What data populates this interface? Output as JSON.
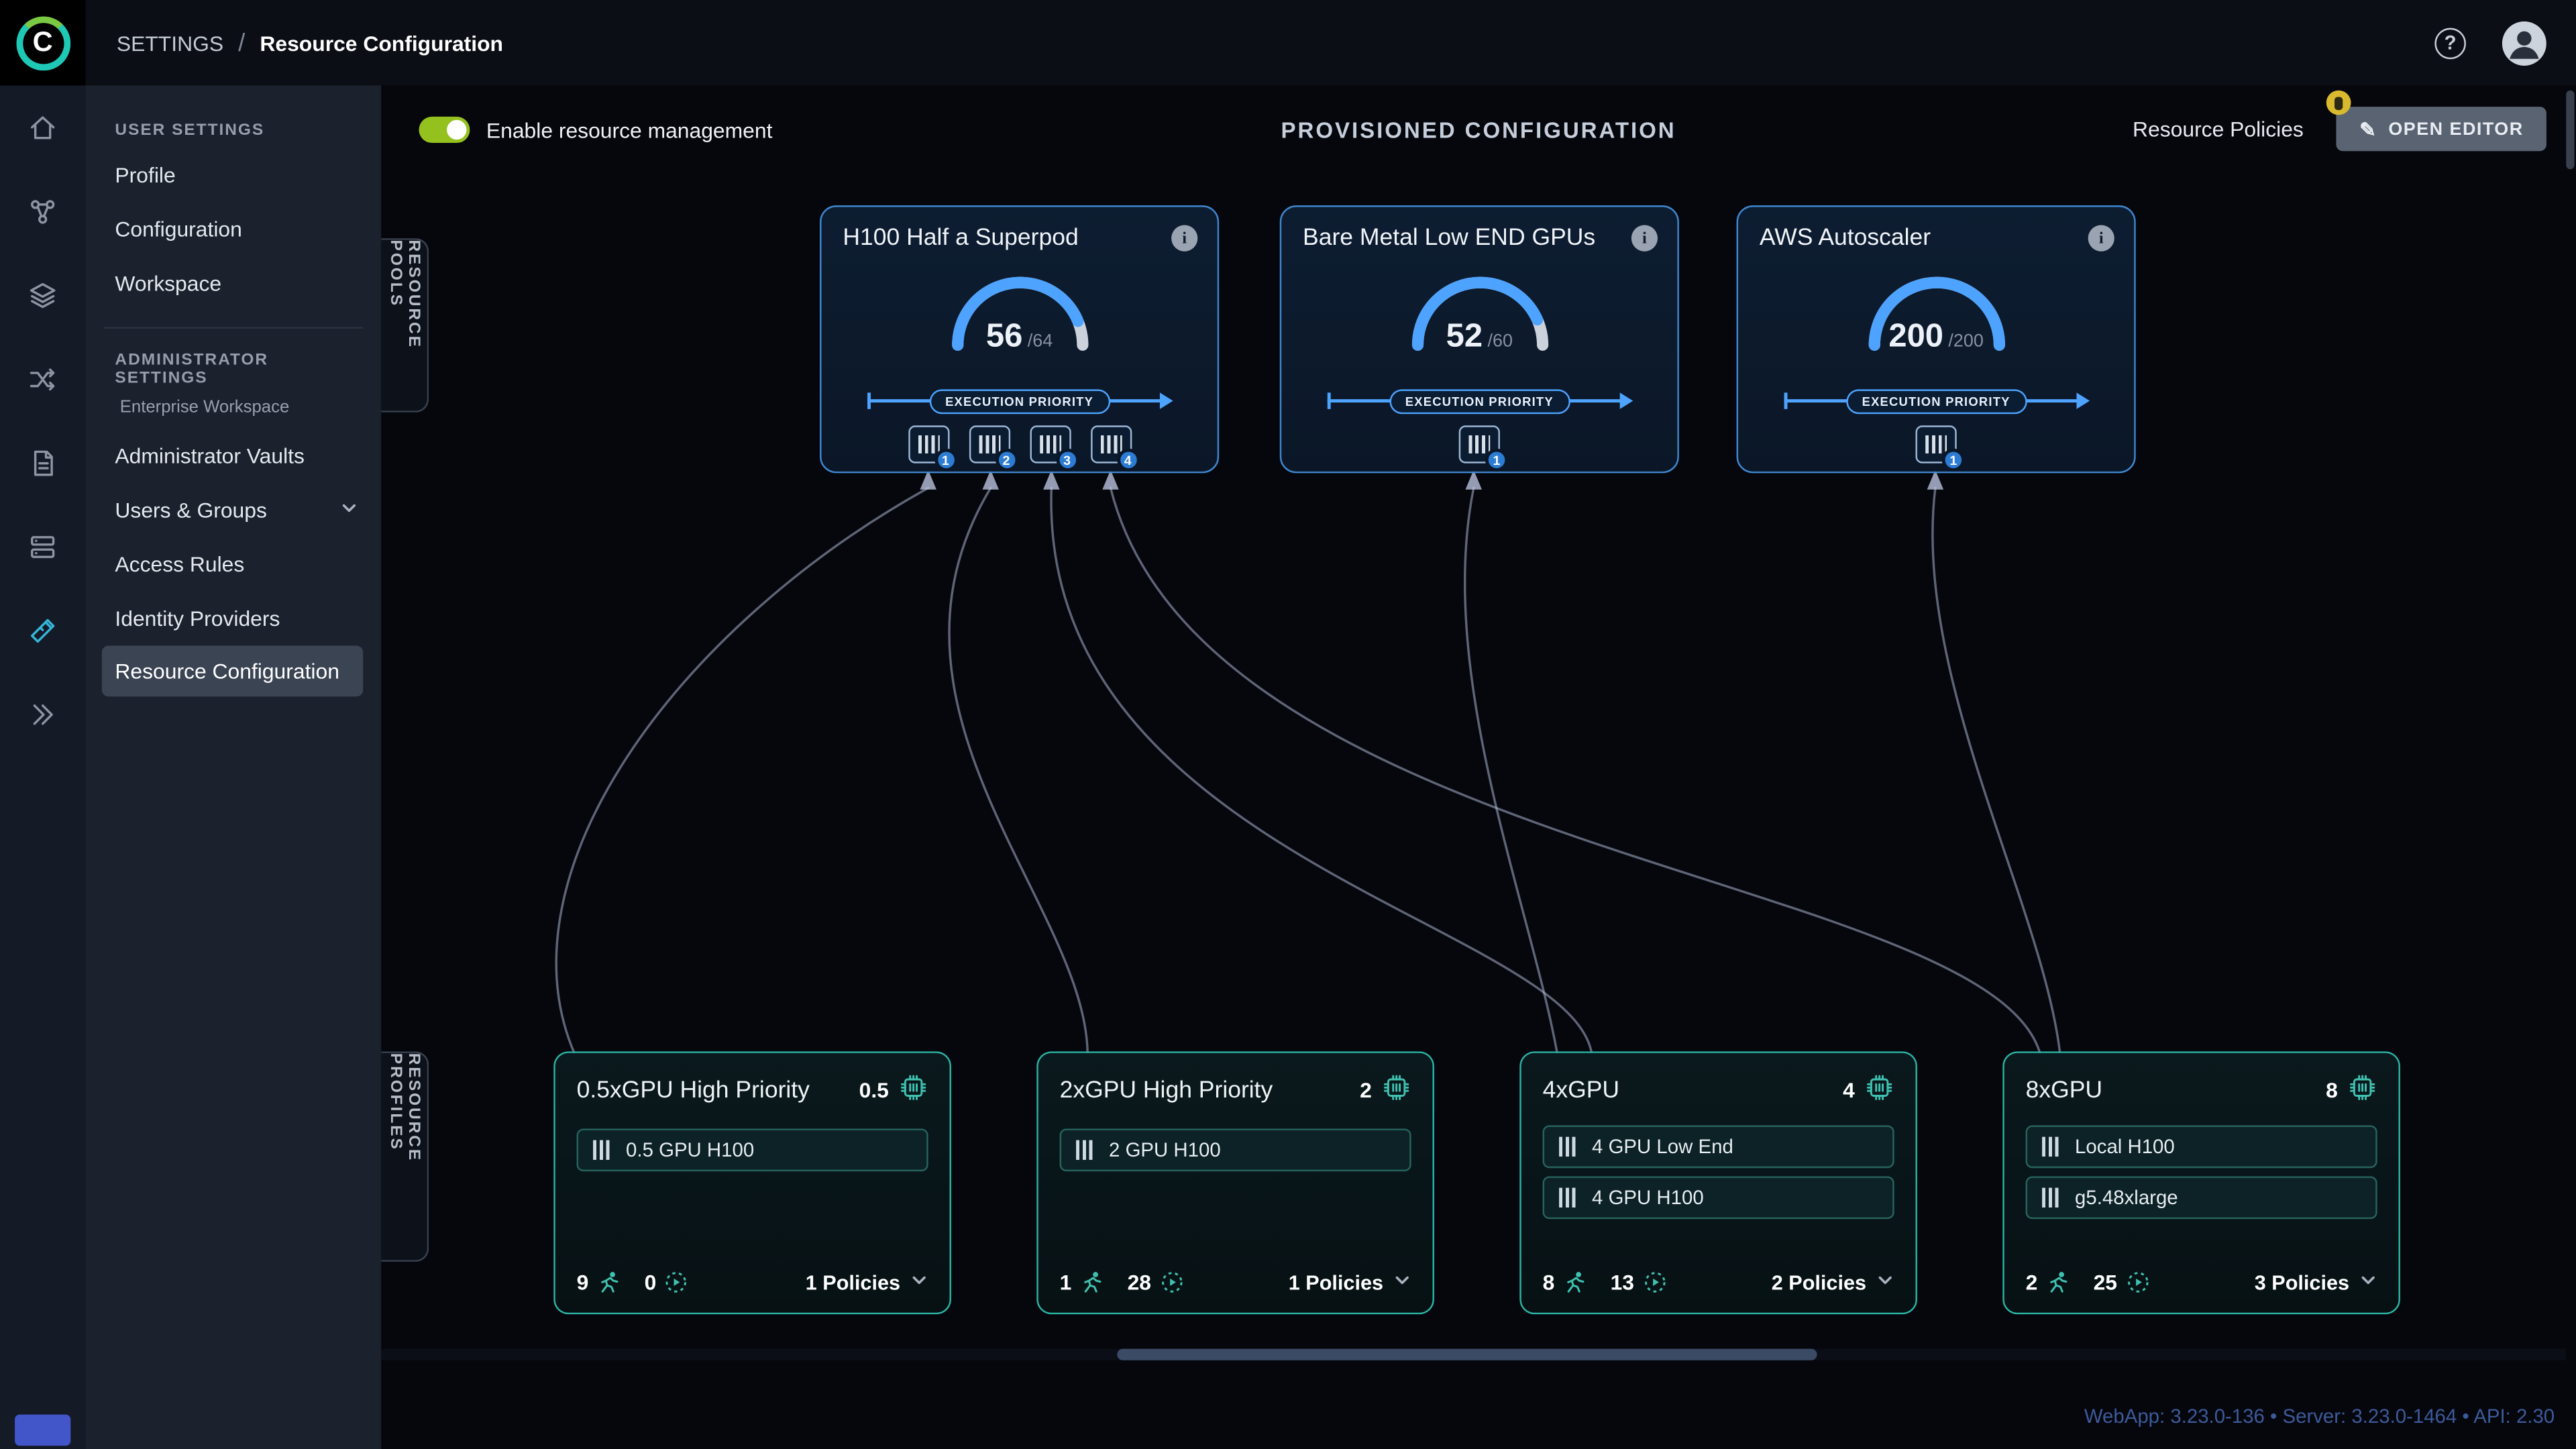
{
  "topbar": {
    "logo_text": "C",
    "section": "SETTINGS",
    "separator": "/",
    "page": "Resource Configuration"
  },
  "icons": {
    "help_glyph": "?",
    "info_glyph": "i",
    "pencil_glyph": "✎"
  },
  "sidebar": {
    "user_settings_header": "USER SETTINGS",
    "user_items": [
      {
        "label": "Profile"
      },
      {
        "label": "Configuration"
      },
      {
        "label": "Workspace"
      }
    ],
    "admin_settings_header": "ADMINISTRATOR SETTINGS",
    "admin_workspace_label": "Enterprise Workspace",
    "admin_items": [
      {
        "label": "Administrator Vaults"
      },
      {
        "label": "Users & Groups",
        "has_chevron": true
      },
      {
        "label": "Access Rules"
      },
      {
        "label": "Identity Providers"
      },
      {
        "label": "Resource Configuration",
        "active": true
      }
    ]
  },
  "header": {
    "toggle_label": "Enable resource management",
    "toggle_enabled": true,
    "title": "PROVISIONED CONFIGURATION",
    "resource_policies": "Resource Policies",
    "open_editor": "OPEN EDITOR"
  },
  "section_labels": {
    "pools": "RESOURCE POOLS",
    "profiles": "RESOURCE PROFILES"
  },
  "pool_card": {
    "execution_priority": "EXECUTION PRIORITY"
  },
  "pools": [
    {
      "name": "H100 Half a Superpod",
      "used": 56,
      "total": 64,
      "used_label": "56",
      "total_label": "/64",
      "gpu_badges": [
        "1",
        "2",
        "3",
        "4"
      ]
    },
    {
      "name": "Bare Metal Low END GPUs",
      "used": 52,
      "total": 60,
      "used_label": "52",
      "total_label": "/60",
      "gpu_badges": [
        "1"
      ]
    },
    {
      "name": "AWS Autoscaler",
      "used": 200,
      "total": 200,
      "used_label": "200",
      "total_label": "/200",
      "gpu_badges": [
        "1"
      ]
    }
  ],
  "profiles": [
    {
      "name": "0.5xGPU High Priority",
      "gpu_count": "0.5",
      "queues": [
        {
          "label": "0.5 GPU H100"
        }
      ],
      "running": "9",
      "pending": "0",
      "policies_label": "1 Policies"
    },
    {
      "name": "2xGPU High Priority",
      "gpu_count": "2",
      "queues": [
        {
          "label": "2 GPU H100"
        }
      ],
      "running": "1",
      "pending": "28",
      "policies_label": "1 Policies"
    },
    {
      "name": "4xGPU",
      "gpu_count": "4",
      "queues": [
        {
          "label": "4 GPU Low End"
        },
        {
          "label": "4 GPU H100"
        }
      ],
      "running": "8",
      "pending": "13",
      "policies_label": "2 Policies"
    },
    {
      "name": "8xGPU",
      "gpu_count": "8",
      "queues": [
        {
          "label": "Local H100"
        },
        {
          "label": "g5.48xlarge"
        }
      ],
      "running": "2",
      "pending": "25",
      "policies_label": "3 Policies"
    }
  ],
  "footer": {
    "versions": "WebApp: 3.23.0-136 • Server: 3.23.0-1464 • API: 2.30"
  },
  "colors": {
    "accent_blue": "#4da3ff",
    "accent_teal": "#2ab3a3",
    "pool_border": "#3f87cf",
    "profile_border": "#2ab3a3",
    "toggle_green": "#95c11f",
    "badge_yellow": "#d9b92e",
    "gpu_badge_blue": "#2c7cd4"
  }
}
